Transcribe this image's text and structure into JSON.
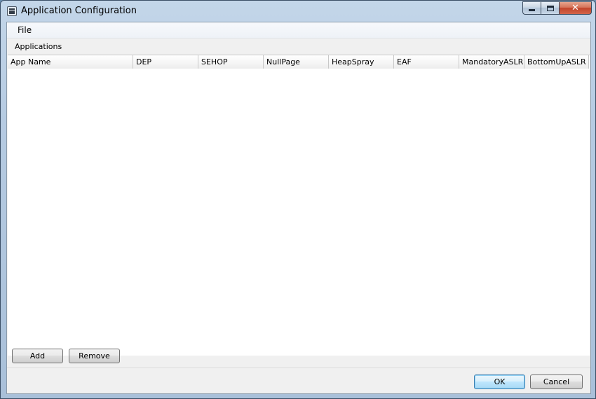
{
  "window": {
    "title": "Application Configuration",
    "caption": {
      "minimize": "",
      "maximize": "",
      "close": "✕"
    }
  },
  "menubar": {
    "file": "File"
  },
  "group": {
    "label": "Applications"
  },
  "grid": {
    "columns": [
      "App Name",
      "DEP",
      "SEHOP",
      "NullPage",
      "HeapSpray",
      "EAF",
      "MandatoryASLR",
      "BottomUpASLR"
    ],
    "rows": []
  },
  "buttons": {
    "add": "Add",
    "remove": "Remove",
    "ok": "OK",
    "cancel": "Cancel"
  },
  "colors": {
    "frame": "#b6cbe2",
    "client_bg": "#f0f0f0",
    "default_button_border": "#3c7fb1",
    "close_button": "#c2452a"
  }
}
